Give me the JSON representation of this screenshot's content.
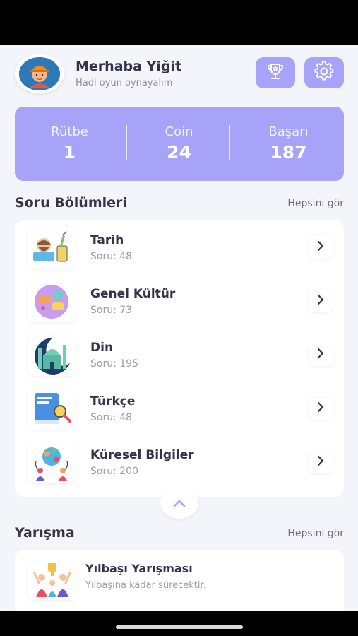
{
  "header": {
    "greeting": "Merhaba Yiğit",
    "subtitle": "Hadi oyun oynayalım",
    "icons": [
      "avatar-icon",
      "trophy-icon",
      "gear-icon"
    ]
  },
  "stats": [
    {
      "label": "Rütbe",
      "value": "1"
    },
    {
      "label": "Coin",
      "value": "24"
    },
    {
      "label": "Başarı",
      "value": "187"
    }
  ],
  "categories_section": {
    "title": "Soru Bölümleri",
    "see_all": "Hepsini gör",
    "items": [
      {
        "name": "Tarih",
        "count": "Soru: 48",
        "icon": "history-icon"
      },
      {
        "name": "Genel Kültür",
        "count": "Soru: 73",
        "icon": "chat-bubbles-icon"
      },
      {
        "name": "Din",
        "count": "Soru: 195",
        "icon": "mosque-icon"
      },
      {
        "name": "Türkçe",
        "count": "Soru: 48",
        "icon": "book-search-icon"
      },
      {
        "name": "Küresel Bilgiler",
        "count": "Soru: 200",
        "icon": "globe-people-icon"
      }
    ]
  },
  "competition_section": {
    "title": "Yarışma",
    "see_all": "Hepsini gör",
    "items": [
      {
        "name": "Yılbaşı Yarışması",
        "desc": "Yılbaşına kadar sürecektir.",
        "icon": "celebrating-people-icon"
      }
    ]
  },
  "colors": {
    "accent": "#a7a3f8",
    "background": "#f3f5fa",
    "text_dark": "#33334a",
    "text_muted": "#9a9cad"
  }
}
